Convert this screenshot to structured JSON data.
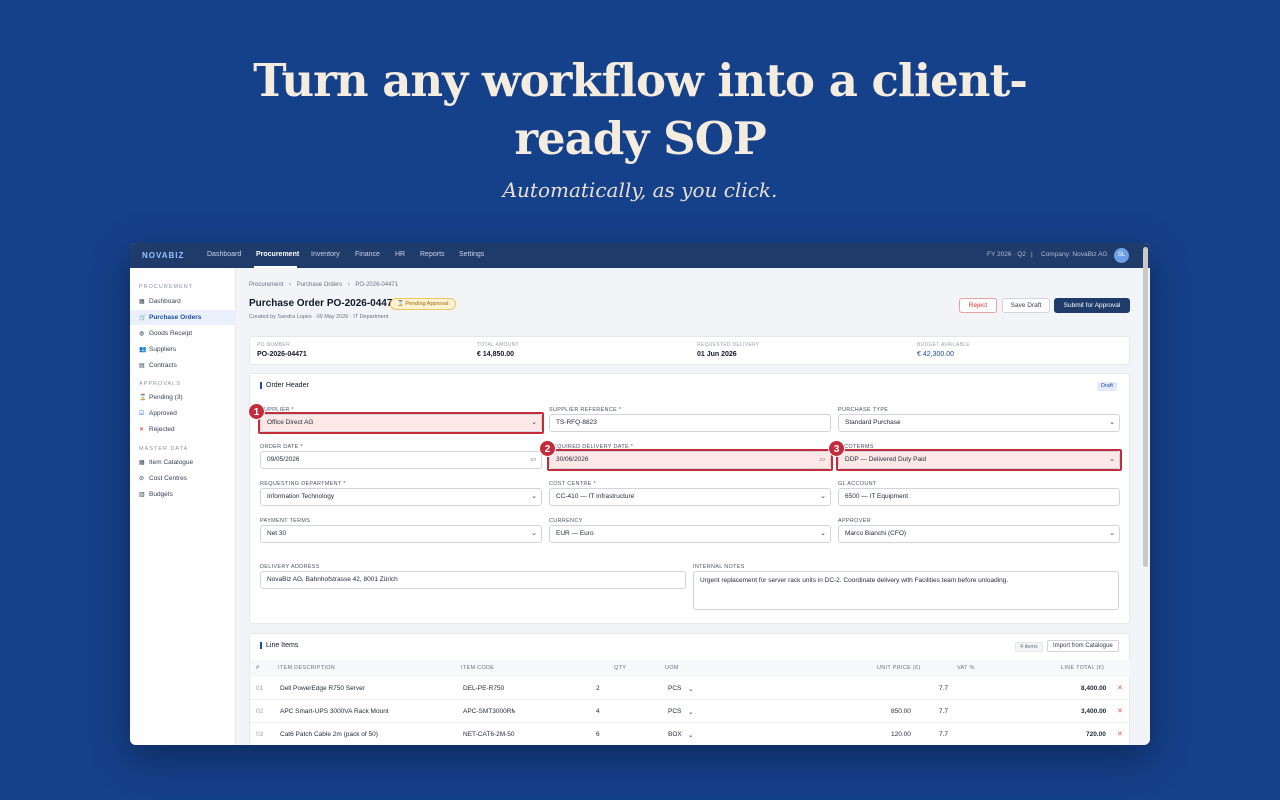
{
  "hero": {
    "title_line1": "Turn any workflow into a client-",
    "title_line2": "ready SOP",
    "subtitle": "Automatically, as you click."
  },
  "topnav": {
    "brand": "NOVABIZ",
    "items": [
      "Dashboard",
      "Procurement",
      "Inventory",
      "Finance",
      "HR",
      "Reports",
      "Settings"
    ],
    "active": "Procurement",
    "period": "FY 2026 · Q2",
    "separator": "|",
    "company": "Company: NovaBiz AG",
    "avatar": "SL"
  },
  "sidebar": {
    "sections": [
      {
        "title": "PROCUREMENT",
        "items": [
          {
            "label": "Dashboard",
            "icon": "▦"
          },
          {
            "label": "Purchase Orders",
            "icon": "🛒"
          },
          {
            "label": "Goods Receipt",
            "icon": "◍"
          },
          {
            "label": "Suppliers",
            "icon": "👥"
          },
          {
            "label": "Contracts",
            "icon": "▤"
          }
        ]
      },
      {
        "title": "APPROVALS",
        "items": [
          {
            "label": "Pending (3)",
            "icon": "⌛"
          },
          {
            "label": "Approved",
            "icon": "☑"
          },
          {
            "label": "Rejected",
            "icon": "✕"
          }
        ]
      },
      {
        "title": "MASTER DATA",
        "items": [
          {
            "label": "Item Catalogue",
            "icon": "▦"
          },
          {
            "label": "Cost Centres",
            "icon": "⊘"
          },
          {
            "label": "Budgets",
            "icon": "▥"
          }
        ]
      }
    ]
  },
  "page": {
    "breadcrumb": [
      "Procurement",
      "›",
      "Purchase Orders",
      "›",
      "PO-2026-04471"
    ],
    "title": "Purchase Order PO-2026-04471",
    "status_badge": "⌛ Pending Approval",
    "meta": "Created by Sandra Lopes · 09 May 2026 · IT Department",
    "buttons": {
      "reject": "Reject",
      "save_draft": "Save Draft",
      "submit": "Submit for Approval"
    }
  },
  "summary": [
    {
      "label": "PO NUMBER",
      "value": "PO-2026-04471"
    },
    {
      "label": "TOTAL AMOUNT",
      "value": "€ 14,850.00"
    },
    {
      "label": "REQUESTED DELIVERY",
      "value": "01 Jun 2026"
    },
    {
      "label": "BUDGET AVAILABLE",
      "value": "€ 42,300.00"
    }
  ],
  "order_header": {
    "title": "Order Header",
    "status_tag": "Draft",
    "fields": {
      "supplier": {
        "label": "SUPPLIER *",
        "value": "Office Direct AG"
      },
      "supplier_ref": {
        "label": "SUPPLIER REFERENCE *",
        "value": "TS-RFQ-8823"
      },
      "purchase_type": {
        "label": "PURCHASE TYPE",
        "value": "Standard Purchase"
      },
      "order_date": {
        "label": "ORDER DATE *",
        "value": "09/05/2026"
      },
      "delivery_date": {
        "label": "REQUIRED DELIVERY DATE *",
        "value": "30/06/2026"
      },
      "incoterms": {
        "label": "INCOTERMS",
        "value": "DDP — Delivered Duty Paid"
      },
      "req_dept": {
        "label": "REQUESTING DEPARTMENT *",
        "value": "Information Technology"
      },
      "cost_centre": {
        "label": "COST CENTRE *",
        "value": "CC-410 — IT Infrastructure"
      },
      "gl_account": {
        "label": "GL ACCOUNT",
        "value": "6500 — IT Equipment"
      },
      "payment_terms": {
        "label": "PAYMENT TERMS",
        "value": "Net 30"
      },
      "currency": {
        "label": "CURRENCY",
        "value": "EUR — Euro"
      },
      "approver": {
        "label": "APPROVER",
        "value": "Marco Bianchi (CFO)"
      },
      "delivery_address": {
        "label": "DELIVERY ADDRESS",
        "value": "NovaBiz AG, Bahnhofstrasse 42, 8001 Zürich"
      },
      "internal_notes": {
        "label": "INTERNAL NOTES",
        "value": "Urgent replacement for server rack units in DC-2. Coordinate delivery with Facilities team before unloading."
      }
    },
    "markers": [
      "1",
      "2",
      "3"
    ]
  },
  "line_items": {
    "title": "Line Items",
    "count": "4 items",
    "import_label": "Import from Catalogue",
    "columns": [
      "#",
      "ITEM DESCRIPTION",
      "ITEM CODE",
      "QTY",
      "UOM",
      "UNIT PRICE (€)",
      "VAT %",
      "LINE TOTAL (€)"
    ],
    "rows": [
      {
        "n": "01",
        "desc": "Dell PowerEdge R750 Server",
        "code": "DEL-PE-R750",
        "qty": "2",
        "uom": "PCS",
        "price": "",
        "vat": "7.7",
        "total": "8,400.00"
      },
      {
        "n": "02",
        "desc": "APC Smart-UPS 3000VA Rack Mount",
        "code": "APC-SMT3000RM",
        "qty": "4",
        "uom": "PCS",
        "price": "850.00",
        "vat": "7.7",
        "total": "3,400.00"
      },
      {
        "n": "03",
        "desc": "Cat6 Patch Cable 2m (pack of 50)",
        "code": "NET-CAT6-2M-50",
        "qty": "6",
        "uom": "BOX",
        "price": "120.00",
        "vat": "7.7",
        "total": "720.00"
      }
    ]
  }
}
